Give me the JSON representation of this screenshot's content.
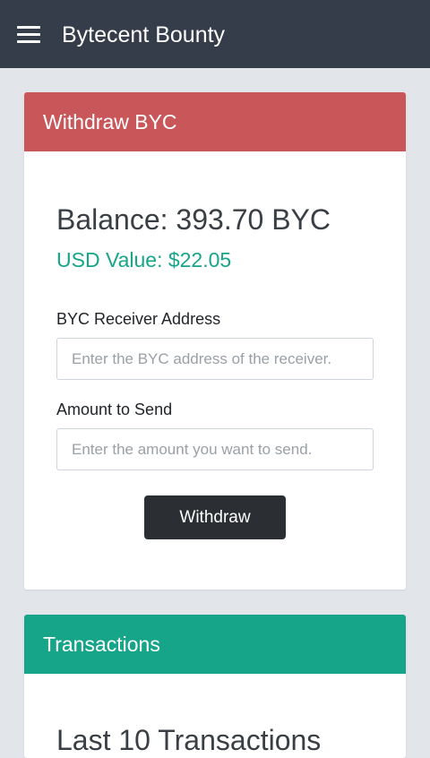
{
  "navbar": {
    "title": "Bytecent Bounty",
    "menu_icon": "hamburger-menu-icon",
    "background": "#343d49"
  },
  "withdraw_card": {
    "header": "Withdraw BYC",
    "header_color": "#c9575a",
    "balance": "Balance: 393.70 BYC",
    "usd_value": "USD Value: $22.05",
    "usd_color": "#17a589",
    "address_label": "BYC Receiver Address",
    "address_placeholder": "Enter the BYC address of the receiver.",
    "address_value": "",
    "amount_label": "Amount to Send",
    "amount_placeholder": "Enter the amount you want to send.",
    "amount_value": "",
    "withdraw_button": "Withdraw"
  },
  "transactions_card": {
    "header": "Transactions",
    "header_color": "#17a589",
    "subtitle": "Last 10 Transactions"
  }
}
